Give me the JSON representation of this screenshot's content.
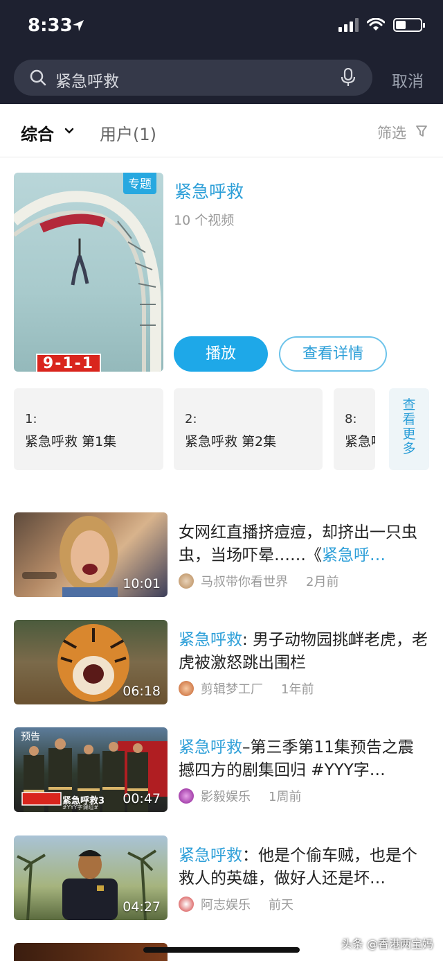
{
  "status": {
    "time": "8:33"
  },
  "search": {
    "query": "紧急呼救",
    "cancel_label": "取消"
  },
  "filter_bar": {
    "tab_all": "综合",
    "tab_users": "用户(1)",
    "filter_label": "筛选"
  },
  "topic": {
    "badge": "专题",
    "title": "紧急呼救",
    "count": "10 个视频",
    "logo_text": "9-1-1",
    "play_label": "播放",
    "detail_label": "查看详情"
  },
  "episodes": [
    {
      "num": "1:",
      "title": "紧急呼救 第1集"
    },
    {
      "num": "2:",
      "title": "紧急呼救 第2集"
    },
    {
      "num": "8:",
      "title": "紧急呼救"
    }
  ],
  "more_label": [
    "查",
    "看",
    "更",
    "多"
  ],
  "videos": [
    {
      "title_pre": "女网红直播挤痘痘，却挤出一只虫虫，当场吓晕……《",
      "title_hl": "紧急呼…",
      "title_post": "",
      "author": "马叔带你看世界",
      "time": "2月前",
      "duration": "10:01",
      "thumb_label": ""
    },
    {
      "title_pre": "",
      "title_hl": "紧急呼救",
      "title_post": ": 男子动物园挑衅老虎，老虎被激怒跳出围栏",
      "author": "剪辑梦工厂",
      "time": "1年前",
      "duration": "06:18",
      "thumb_label": ""
    },
    {
      "title_pre": "",
      "title_hl": "紧急呼救",
      "title_post": "–第三季第11集预告之震撼四方的剧集回归 #YYY字…",
      "author": "影毅娱乐",
      "time": "1周前",
      "duration": "00:47",
      "thumb_label": "预告",
      "thumb_caption": "紧急呼救3",
      "thumb_sub": "#YYY字课组#"
    },
    {
      "title_pre": "",
      "title_hl": "紧急呼救",
      "title_post": "：他是个偷车贼，也是个救人的英雄，做好人还是坏…",
      "author": "阿志娱乐",
      "time": "前天",
      "duration": "04:27",
      "thumb_label": ""
    }
  ],
  "watermark": "头条 @香港两宝妈",
  "colors": {
    "accent": "#2d9fd8",
    "header_bg": "#1e2130",
    "badge": "#27a8e0"
  }
}
